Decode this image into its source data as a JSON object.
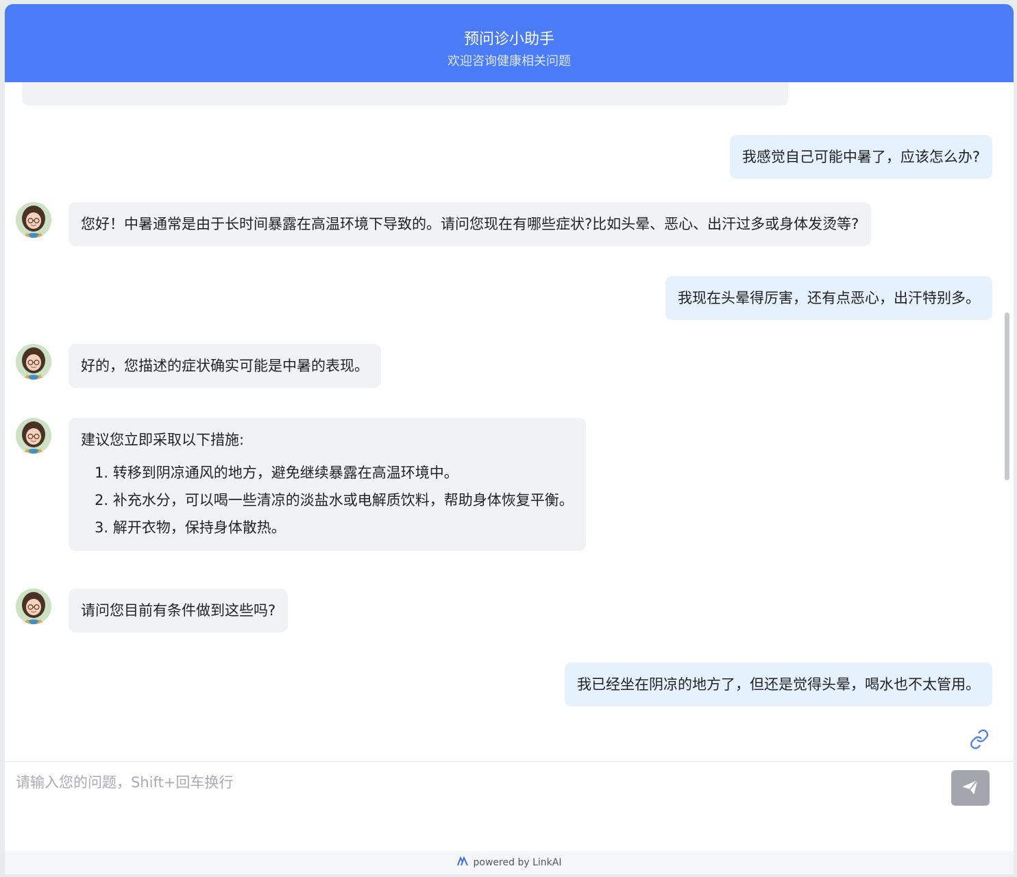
{
  "header": {
    "title": "预问诊小助手",
    "subtitle": "欢迎咨询健康相关问题"
  },
  "messages": [
    {
      "role": "user",
      "text": "我感觉自己可能中暑了，应该怎么办?"
    },
    {
      "role": "bot",
      "text": "您好！中暑通常是由于长时间暴露在高温环境下导致的。请问您现在有哪些症状?比如头晕、恶心、出汗过多或身体发烫等?"
    },
    {
      "role": "user",
      "text": "我现在头晕得厉害，还有点恶心，出汗特别多。"
    },
    {
      "role": "bot",
      "text": "好的，您描述的症状确实可能是中暑的表现。"
    },
    {
      "role": "bot",
      "text": "建议您立即采取以下措施:",
      "list": [
        "1. 转移到阴凉通风的地方，避免继续暴露在高温环境中。",
        "2. 补充水分，可以喝一些清凉的淡盐水或电解质饮料，帮助身体恢复平衡。",
        "3. 解开衣物，保持身体散热。"
      ]
    },
    {
      "role": "bot",
      "text": "请问您目前有条件做到这些吗?"
    },
    {
      "role": "user",
      "text": "我已经坐在阴凉的地方了，但还是觉得头晕，喝水也不太管用。"
    }
  ],
  "input": {
    "placeholder": "请输入您的问题，Shift+回车换行",
    "value": ""
  },
  "footer": {
    "text": "powered by LinkAI"
  },
  "icons": {
    "link": "link-icon",
    "send": "send-icon",
    "brand": "linkai-logo-icon",
    "avatar": "assistant-avatar"
  },
  "colors": {
    "header": "#4a7cf7",
    "user_bubble": "#e5f1fd",
    "bot_bubble": "#f1f2f4",
    "send_button": "#a3a6ad",
    "link_icon": "#4a7cf7"
  }
}
